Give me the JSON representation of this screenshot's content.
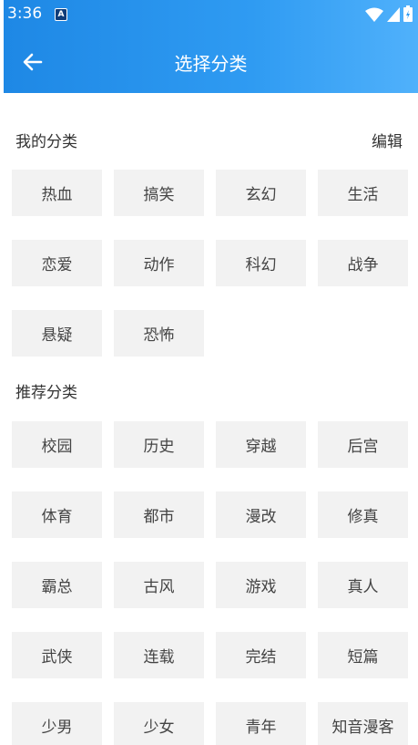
{
  "status_bar": {
    "time": "3:36",
    "notif_letter": "A"
  },
  "header": {
    "title": "选择分类"
  },
  "my_categories": {
    "title": "我的分类",
    "edit_label": "编辑",
    "items": [
      "热血",
      "搞笑",
      "玄幻",
      "生活",
      "恋爱",
      "动作",
      "科幻",
      "战争",
      "悬疑",
      "恐怖"
    ]
  },
  "recommended": {
    "title": "推荐分类",
    "items": [
      "校园",
      "历史",
      "穿越",
      "后宫",
      "体育",
      "都市",
      "漫改",
      "修真",
      "霸总",
      "古风",
      "游戏",
      "真人",
      "武侠",
      "连载",
      "完结",
      "短篇",
      "少男",
      "少女",
      "青年",
      "知音漫客"
    ]
  },
  "colors": {
    "header_start": "#1e88e5",
    "header_end": "#50b1fb",
    "chip_bg": "#f2f2f2"
  }
}
